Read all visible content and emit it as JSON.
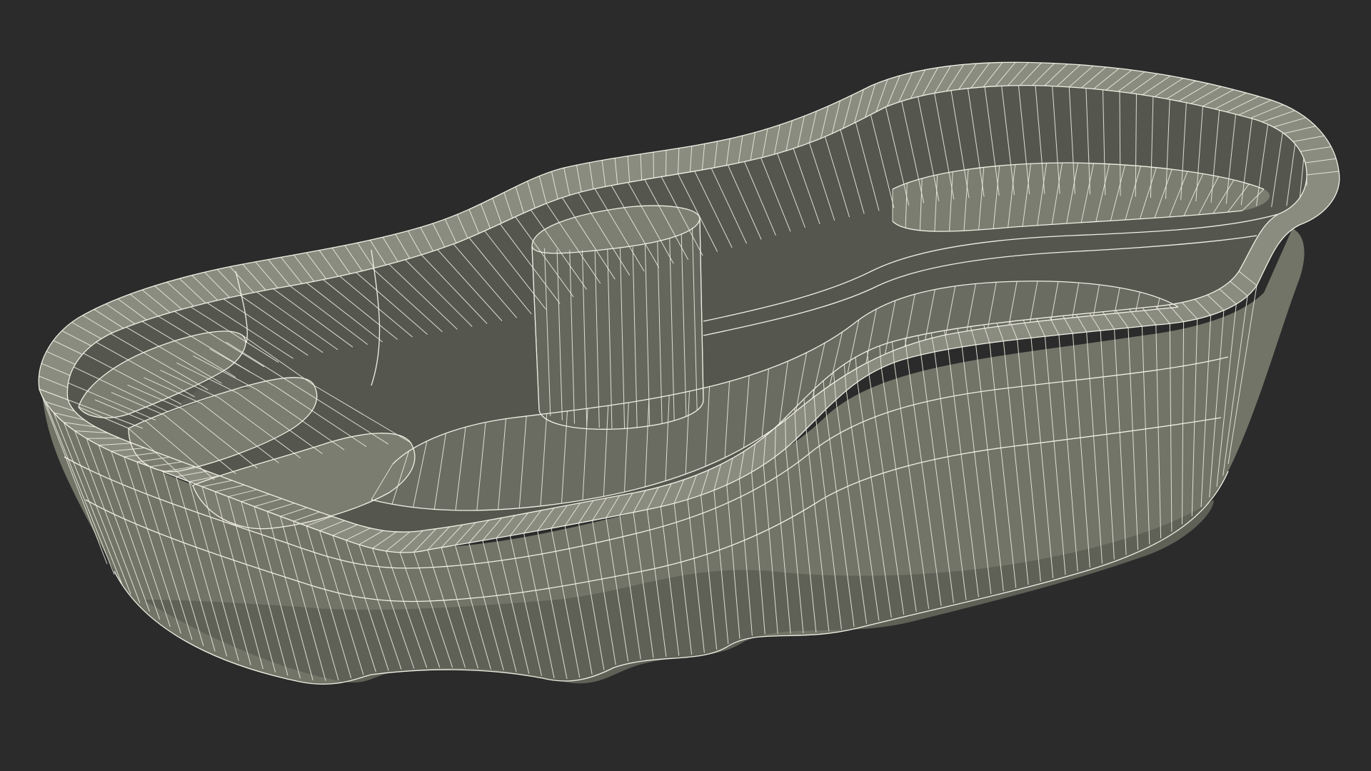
{
  "scene": {
    "subject": "pond-liner-wireframe",
    "colors": {
      "background": "#2b2b2b",
      "surface": "#727467",
      "wire": "#f2f0e6"
    }
  }
}
